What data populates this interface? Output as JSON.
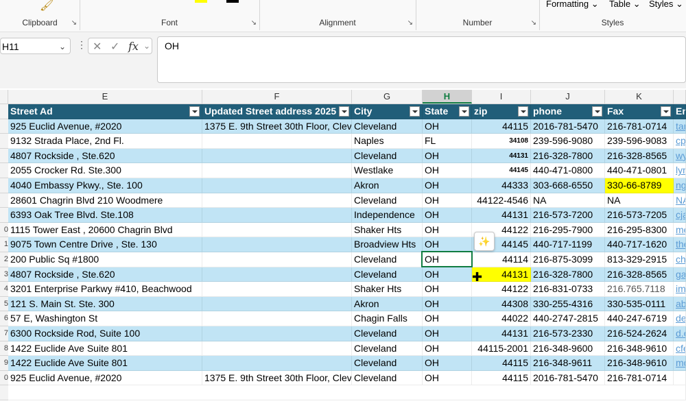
{
  "ribbon": {
    "groups": [
      {
        "label": "Clipboard",
        "launcher": "↘"
      },
      {
        "label": "Font",
        "launcher": "↘"
      },
      {
        "label": "Alignment",
        "launcher": "↘"
      },
      {
        "label": "Number",
        "launcher": "↘"
      },
      {
        "label": "Styles"
      }
    ],
    "styles_buttons": [
      "Formatting ⌄",
      "Table ⌄",
      "Styles ⌄"
    ],
    "font_color_swatch": "#ffff00",
    "fill_color_swatch": "#000000"
  },
  "formula_bar": {
    "name_box": "H11",
    "formula": "OH",
    "fx_label": "fx"
  },
  "columns": [
    "E",
    "F",
    "G",
    "H",
    "I",
    "J",
    "K"
  ],
  "row_numbers": [
    "",
    "",
    "",
    "",
    "",
    "",
    "",
    "",
    "0",
    "1",
    "2",
    "3",
    "4",
    "5",
    "6",
    "7",
    "8",
    "9",
    "0",
    ""
  ],
  "header": [
    "Street Ad",
    "Updated Street address 2025",
    "City",
    "State",
    "zip",
    "phone",
    "Fax",
    "Em"
  ],
  "rows": [
    [
      "925 Euclid Avenue, #2020",
      "1375 E. 9th Street 30th Floor, Clev",
      "Cleveland",
      "OH",
      "44115",
      "2016-781-5470",
      "216-781-0714",
      "tar"
    ],
    [
      "9132 Strada Place, 2nd Fl.",
      "",
      "Naples",
      "FL",
      "34108",
      "239-596-9080",
      "239-596-9083",
      "cp"
    ],
    [
      "4807 Rockside , Ste.620",
      "",
      "Cleveland",
      "OH",
      "44131",
      "216-328-7800",
      "216-328-8565",
      "wy"
    ],
    [
      "2055 Crocker Rd. Ste.300",
      "",
      "Westlake",
      "OH",
      "44145",
      "440-471-0800",
      "440-471-0801",
      "lyn"
    ],
    [
      "4040 Embassy Pkwy., Ste. 100",
      "",
      "Akron",
      "OH",
      "44333",
      "303-668-6550",
      "330-66-8789",
      "ng"
    ],
    [
      "28601 Chagrin Blvd 210 Woodmere",
      "",
      "Cleveland",
      "OH",
      "44122-4546",
      "NA",
      "NA",
      "NA"
    ],
    [
      "6393 Oak Tree Blvd. Ste.108",
      "",
      "Independence",
      "OH",
      "44131",
      "216-573-7200",
      "216-573-7205",
      "cja"
    ],
    [
      "1115 Tower East , 20600 Chagrin Blvd",
      "",
      "Shaker Hts",
      "OH",
      "44122",
      "216-295-7900",
      "216-295-8300",
      "me"
    ],
    [
      "9075 Town Centre Drive , Ste. 130",
      "",
      "Broadview Hts",
      "OH",
      "44145",
      "440-717-1199",
      "440-717-1620",
      "the"
    ],
    [
      "200 Public Sq #1800",
      "",
      "Cleveland",
      "OH",
      "44114",
      "216-875-3099",
      "813-329-2915",
      "ch"
    ],
    [
      "4807 Rockside , Ste.620",
      "",
      "Cleveland",
      "OH",
      "44131",
      "216-328-7800",
      "216-328-8565",
      "ga"
    ],
    [
      "3201 Enterprise Parkwy #410, Beachwood",
      "",
      "Shaker Hts",
      "OH",
      "44122",
      "216-831-0733",
      "216.765.7118",
      "im"
    ],
    [
      "121 S. Main St. Ste. 300",
      "",
      "Akron",
      "OH",
      "44308",
      "330-255-4316",
      "330-535-0111",
      "ab"
    ],
    [
      "57 E, Washington St",
      "",
      "Chagin Falls",
      "OH",
      "44022",
      "440-2747-2815",
      "440-247-6719",
      "de"
    ],
    [
      "6300 Rockside Rod, Suite 100",
      "",
      "Cleveland",
      "OH",
      "44131",
      "216-573-2330",
      "216-524-2624",
      "d.e"
    ],
    [
      "1422 Euclide Ave Suite 801",
      "",
      "Cleveland",
      "OH",
      "44115-2001",
      "216-348-9600",
      "216-348-9610",
      "cfe"
    ],
    [
      "1422 Euclide Ave Suite 801",
      "",
      "Cleveland",
      "OH",
      "44115",
      "216-348-9611",
      "216-348-9610",
      "md"
    ],
    [
      "925 Euclid Avenue, #2020",
      "1375 E. 9th Street 30th Floor, Clev",
      "Cleveland",
      "OH",
      "44115",
      "2016-781-5470",
      "216-781-0714",
      ""
    ]
  ],
  "highlight_color": "#ffff00",
  "band_color": "#c1e4f5",
  "header_color": "#215e79",
  "selected_cell": "H11"
}
